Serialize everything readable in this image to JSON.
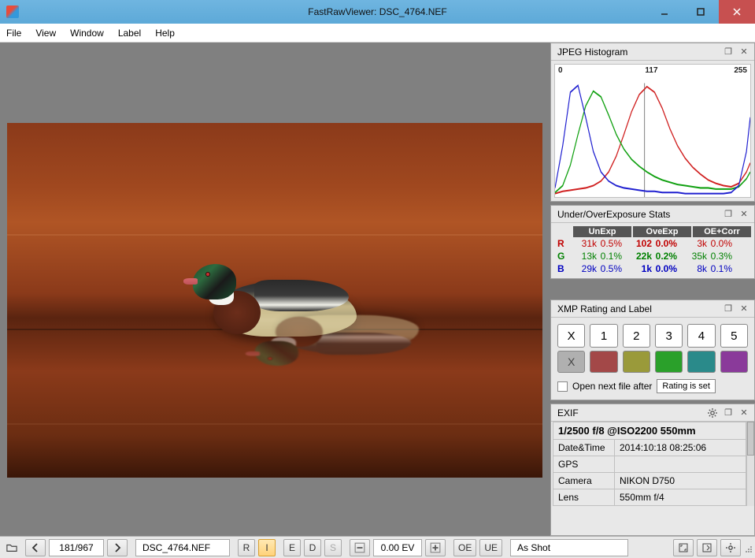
{
  "window": {
    "title": "FastRawViewer: DSC_4764.NEF"
  },
  "menu": {
    "file": "File",
    "view": "View",
    "window": "Window",
    "label": "Label",
    "help": "Help"
  },
  "histogram": {
    "title": "JPEG Histogram",
    "axis": {
      "min": "0",
      "mid": "117",
      "max": "255"
    },
    "marker_x": 117
  },
  "chart_data": {
    "type": "line",
    "title": "JPEG Histogram",
    "xlabel": "",
    "ylabel": "",
    "xlim": [
      0,
      255
    ],
    "x_ticks": [
      0,
      117,
      255
    ],
    "x": [
      0,
      10,
      20,
      30,
      40,
      50,
      60,
      70,
      80,
      90,
      100,
      110,
      120,
      130,
      140,
      150,
      160,
      170,
      180,
      190,
      200,
      210,
      220,
      230,
      240,
      250,
      255
    ],
    "series": [
      {
        "name": "R",
        "color": "#d02020",
        "values": [
          0.03,
          0.05,
          0.06,
          0.07,
          0.08,
          0.1,
          0.14,
          0.22,
          0.36,
          0.55,
          0.75,
          0.9,
          0.97,
          0.92,
          0.78,
          0.6,
          0.45,
          0.34,
          0.26,
          0.2,
          0.15,
          0.12,
          0.1,
          0.09,
          0.12,
          0.22,
          0.3
        ]
      },
      {
        "name": "G",
        "color": "#10a010",
        "values": [
          0.04,
          0.1,
          0.28,
          0.55,
          0.8,
          0.93,
          0.88,
          0.72,
          0.55,
          0.42,
          0.33,
          0.27,
          0.22,
          0.18,
          0.15,
          0.13,
          0.11,
          0.1,
          0.09,
          0.08,
          0.08,
          0.07,
          0.07,
          0.07,
          0.09,
          0.16,
          0.22
        ]
      },
      {
        "name": "B",
        "color": "#2020d0",
        "values": [
          0.08,
          0.45,
          0.92,
          0.98,
          0.7,
          0.4,
          0.22,
          0.14,
          0.1,
          0.08,
          0.07,
          0.06,
          0.05,
          0.05,
          0.04,
          0.04,
          0.04,
          0.03,
          0.03,
          0.03,
          0.03,
          0.03,
          0.03,
          0.04,
          0.1,
          0.4,
          0.7
        ]
      }
    ]
  },
  "exposure": {
    "title": "Under/OverExposure Stats",
    "headers": {
      "un": "UnExp",
      "ov": "OveExp",
      "oc": "OE+Corr"
    },
    "rows": [
      {
        "ch": "R",
        "cls": "R",
        "un_k": "31k",
        "un_p": "0.5%",
        "ov_k": "102",
        "ov_p": "0.0%",
        "ov_bold": true,
        "oc_k": "3k",
        "oc_p": "0.0%"
      },
      {
        "ch": "G",
        "cls": "G",
        "un_k": "13k",
        "un_p": "0.1%",
        "ov_k": "22k",
        "ov_p": "0.2%",
        "ov_bold": true,
        "oc_k": "35k",
        "oc_p": "0.3%"
      },
      {
        "ch": "B",
        "cls": "B",
        "un_k": "29k",
        "un_p": "0.5%",
        "ov_k": "1k",
        "ov_p": "0.0%",
        "ov_bold": true,
        "oc_k": "8k",
        "oc_p": "0.1%"
      }
    ]
  },
  "rating": {
    "title": "XMP Rating and Label",
    "buttons": [
      "X",
      "1",
      "2",
      "3",
      "4",
      "5"
    ],
    "colors": [
      "#b0b0b0",
      "#a34848",
      "#9a9a3a",
      "#2aa02a",
      "#2a8a8a",
      "#8a3a9a"
    ],
    "x_label": "X",
    "open_next": "Open next file after",
    "drop": "Rating is set"
  },
  "exif": {
    "title": "EXIF",
    "summary": "1/2500 f/8 @ISO2200 550mm",
    "rows": [
      {
        "k": "Date&Time",
        "v": "2014:10:18 08:25:06"
      },
      {
        "k": "GPS",
        "v": ""
      },
      {
        "k": "Camera",
        "v": "NIKON D750"
      },
      {
        "k": "Lens",
        "v": "550mm f/4"
      }
    ]
  },
  "status": {
    "counter": "181/967",
    "filename": "DSC_4764.NEF",
    "r": "R",
    "i": "I",
    "e": "E",
    "d": "D",
    "s": "S",
    "ev": "0.00 EV",
    "oe": "OE",
    "ue": "UE",
    "wb": "As Shot"
  }
}
